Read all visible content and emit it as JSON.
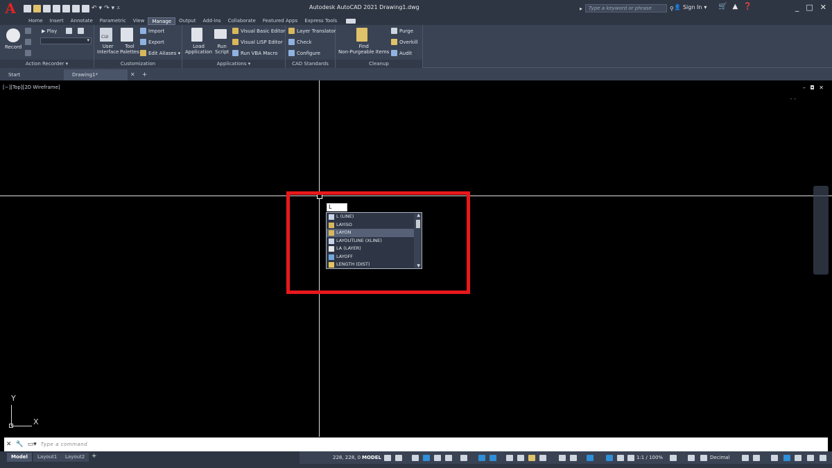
{
  "title_bar": {
    "app_title": "Autodesk AutoCAD 2021   Drawing1.dwg",
    "logo_letter": "A",
    "search_placeholder": "Type a keyword or phrase",
    "sign_in": "Sign In"
  },
  "ribbon_tabs": [
    "Home",
    "Insert",
    "Annotate",
    "Parametric",
    "View",
    "Manage",
    "Output",
    "Add-ins",
    "Collaborate",
    "Featured Apps",
    "Express Tools"
  ],
  "active_tab": "Manage",
  "ribbon": {
    "action_recorder": {
      "title": "Action Recorder ▾",
      "record": "Record",
      "play": "Play"
    },
    "customization": {
      "title": "Customization",
      "user_interface": "User\nInterface",
      "cui": "CUI",
      "tool_palettes": "Tool\nPalettes",
      "import": "Import",
      "export": "Export",
      "edit_aliases": "Edit Aliases ▾"
    },
    "applications": {
      "title": "Applications ▾",
      "load_application": "Load\nApplication",
      "run_script": "Run\nScript",
      "vba_editor": "Visual Basic Editor",
      "lisp_editor": "Visual LISP Editor",
      "run_vba": "Run VBA Macro"
    },
    "cad_standards": {
      "title": "CAD Standards",
      "layer_translator": "Layer Translator",
      "check": "Check",
      "configure": "Configure"
    },
    "cleanup": {
      "title": "Cleanup",
      "find_nonpurgeable": "Find\nNon-Purgeable Items",
      "purge": "Purge",
      "overkill": "Overkill",
      "audit": "Audit"
    }
  },
  "doc_tabs": {
    "start": "Start",
    "drawing": "Drawing1*",
    "close": "✕",
    "add": "+"
  },
  "viewport": {
    "label": "[−][Top][2D Wireframe]",
    "controls": "– ◘ ✕"
  },
  "command_input": {
    "value": "L"
  },
  "autocomplete": [
    {
      "label": "L (LINE)",
      "icon": "line-icon",
      "color": "#c9d3e6"
    },
    {
      "label": "LAYISO",
      "icon": "layer-isolate-icon",
      "color": "#d9b85c"
    },
    {
      "label": "LAYON",
      "icon": "layer-on-icon",
      "color": "#d9b85c"
    },
    {
      "label": "LAYOUTLINE (XLINE)",
      "icon": "xline-icon",
      "color": "#c9d3e6"
    },
    {
      "label": "LA (LAYER)",
      "icon": "layer-properties-icon",
      "color": "#e6e6e6"
    },
    {
      "label": "LAYOFF",
      "icon": "layer-off-icon",
      "color": "#6fa8dc"
    },
    {
      "label": "LENGTH (DIST)",
      "icon": "measure-distance-icon",
      "color": "#e6c35c"
    }
  ],
  "autocomplete_selected": 2,
  "ucs": {
    "x": "X",
    "y": "Y"
  },
  "command_line": {
    "prompt": "Type a command"
  },
  "layout_tabs": [
    "Model",
    "Layout1",
    "Layout2"
  ],
  "layout_add": "+",
  "status": {
    "coords": "228, 228, 0",
    "model": "MODEL",
    "annotation_scale": "1:1 / 100%",
    "units": "Decimal"
  },
  "colors": {
    "highlight": "#e8181c",
    "ribbon": "#3a4354",
    "titlebar": "#2e3644"
  }
}
